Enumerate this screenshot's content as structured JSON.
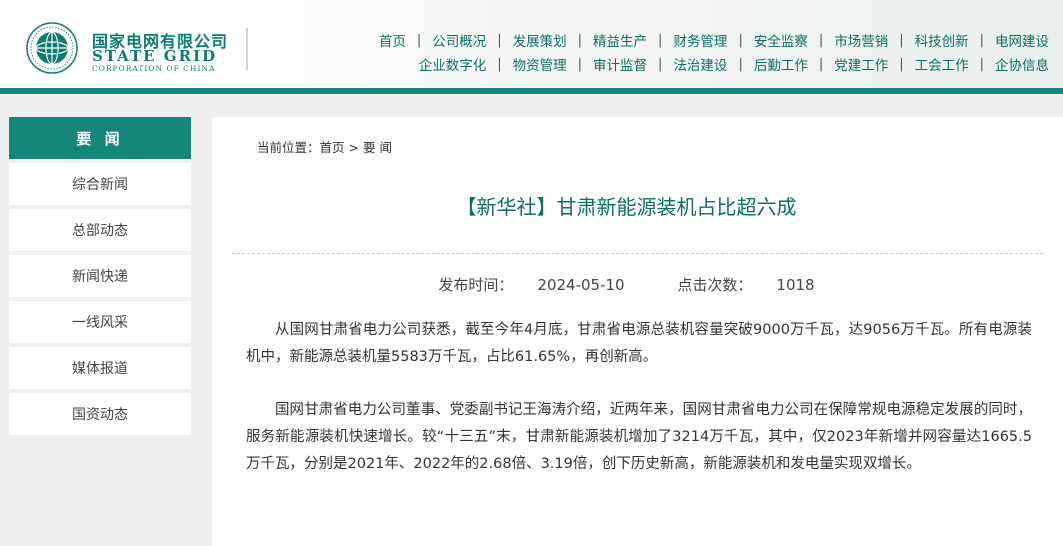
{
  "header": {
    "logo_cn": "国家电网有限公司",
    "logo_en": "STATE GRID",
    "logo_en_sub": "CORPORATION OF CHINA",
    "brand_color": "#14877c"
  },
  "nav": {
    "row1": [
      "首页",
      "公司概况",
      "发展策划",
      "精益生产",
      "财务管理",
      "安全监察",
      "市场营销",
      "科技创新",
      "电网建设"
    ],
    "row2": [
      "企业数字化",
      "物资管理",
      "审计监督",
      "法治建设",
      "后勤工作",
      "党建工作",
      "工会工作",
      "企协信息"
    ],
    "separator": "|"
  },
  "sidebar": {
    "title": "要 闻",
    "items": [
      "综合新闻",
      "总部动态",
      "新闻快递",
      "一线风采",
      "媒体报道",
      "国资动态"
    ]
  },
  "breadcrumb": {
    "prefix": "当前位置：",
    "home": "首页",
    "arrow": ">",
    "current": "要 闻"
  },
  "article": {
    "title": "【新华社】甘肃新能源装机占比超六成",
    "publish_label": "发布时间：",
    "publish_date": "2024-05-10",
    "clicks_label": "点击次数：",
    "clicks": "1018",
    "paragraphs": [
      "从国网甘肃省电力公司获悉，截至今年4月底，甘肃省电源总装机容量突破9000万千瓦，达9056万千瓦。所有电源装机中，新能源总装机量5583万千瓦，占比61.65%，再创新高。",
      "国网甘肃省电力公司董事、党委副书记王海涛介绍，近两年来，国网甘肃省电力公司在保障常规电源稳定发展的同时，服务新能源装机快速增长。较“十三五”末，甘肃新能源装机增加了3214万千瓦，其中，仅2023年新增并网容量达1665.5万千瓦，分别是2021年、2022年的2.68倍、3.19倍，创下历史新高，新能源装机和发电量实现双增长。"
    ]
  }
}
